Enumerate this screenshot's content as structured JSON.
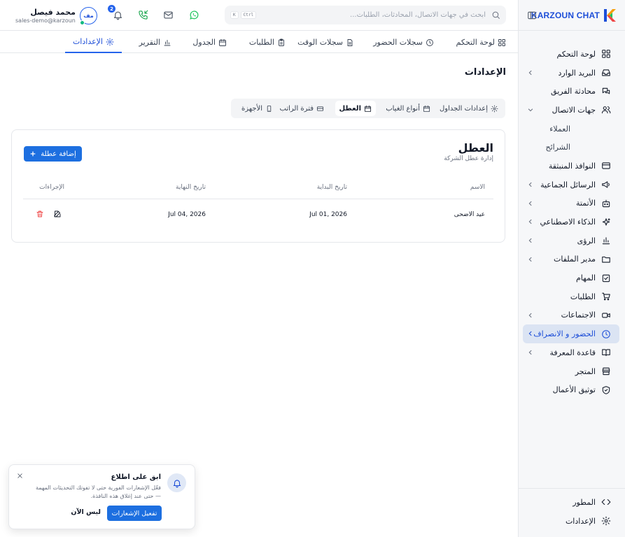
{
  "brand": {
    "name": "KARZOUN CHAT"
  },
  "search": {
    "placeholder": "ابحث في جهات الاتصال، المحادثات، الطلبات...",
    "kbd_ctrl": "Ctrl",
    "kbd_k": "K"
  },
  "user": {
    "name": "محمد فيصل",
    "email": "sales-demo@karzoun...",
    "initials": "مف",
    "notifications": "2"
  },
  "tabs": [
    {
      "label": "لوحة التحكم",
      "icon": "grid-icon"
    },
    {
      "label": "سجلات الحضور",
      "icon": "clock-icon"
    },
    {
      "label": "سجلات الوقت",
      "icon": "file-icon"
    },
    {
      "label": "الطلبات",
      "icon": "clipboard-icon"
    },
    {
      "label": "الجدول",
      "icon": "calendar-icon"
    },
    {
      "label": "التقرير",
      "icon": "bar-chart-icon"
    },
    {
      "label": "الإعدادات",
      "icon": "gear-icon"
    }
  ],
  "page": {
    "title": "الإعدادات"
  },
  "subtabs": [
    {
      "label": "إعدادات الجداول"
    },
    {
      "label": "أنواع الغياب"
    },
    {
      "label": "العطل"
    },
    {
      "label": "فترة الراتب"
    },
    {
      "label": "الأجهزة"
    }
  ],
  "holidays": {
    "title": "العطل",
    "subtitle": "إدارة عطل الشركة",
    "add_label": "إضافة عطلة",
    "columns": {
      "name": "الاسم",
      "start": "تاريخ البداية",
      "end": "تاريخ النهاية",
      "actions": "الإجراءات"
    },
    "rows": [
      {
        "name": "عيد الاضحى",
        "start": "Jul 01, 2026",
        "end": "Jul 04, 2026"
      }
    ]
  },
  "sidebar": {
    "items": [
      {
        "label": "لوحة التحكم"
      },
      {
        "label": "البريد الوارد"
      },
      {
        "label": "محادثة الفريق"
      },
      {
        "label": "جهات الاتصال"
      },
      {
        "label": "العملاء"
      },
      {
        "label": "الشرائح"
      },
      {
        "label": "النوافذ المنبثقة"
      },
      {
        "label": "الرسائل الجماعية"
      },
      {
        "label": "الأتمتة"
      },
      {
        "label": "الذكاء الاصطناعي"
      },
      {
        "label": "الرؤى"
      },
      {
        "label": "مدير الملفات"
      },
      {
        "label": "المهام"
      },
      {
        "label": "الطلبات"
      },
      {
        "label": "الاجتماعات"
      },
      {
        "label": "الحضور و الانصراف"
      },
      {
        "label": "قاعدة المعرفة"
      },
      {
        "label": "المتجر"
      },
      {
        "label": "توثيق الأعمال"
      }
    ],
    "bottom": [
      {
        "label": "المطور"
      },
      {
        "label": "الإعدادات"
      }
    ]
  },
  "toast": {
    "title": "ابق على اطلاع",
    "message": "فعّل الإشعارات الفورية حتى لا تفوتك التحديثات المهمة — حتى عند إغلاق هذه النافذة.",
    "primary": "تفعيل الإشعارات",
    "secondary": "ليس الآن"
  },
  "colors": {
    "accent": "#2563eb",
    "active_bg": "#dbe4f3",
    "whatsapp": "#22c55e"
  }
}
